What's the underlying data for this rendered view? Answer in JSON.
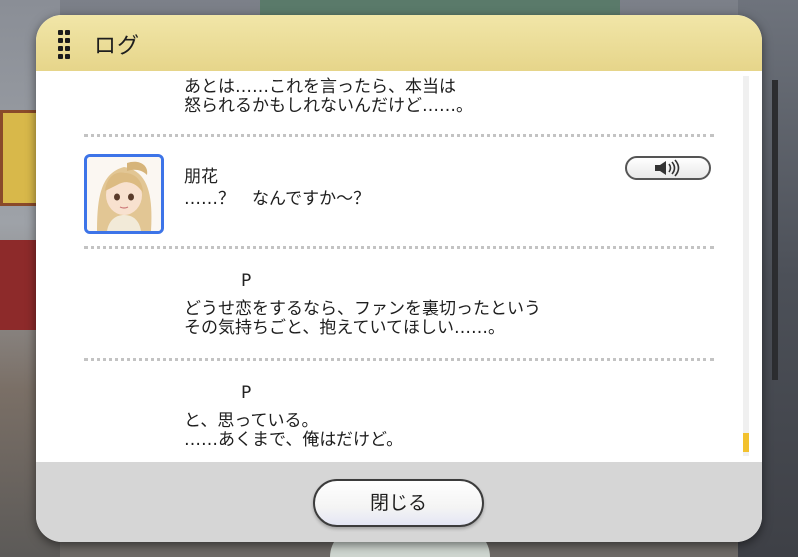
{
  "dialog": {
    "title": "ログ",
    "close_label": "閉じる"
  },
  "log": {
    "entries": [
      {
        "speaker": "",
        "lines": [
          "あとは……これを言ったら、本当は",
          "怒られるかもしれないんだけど……。"
        ]
      },
      {
        "speaker": "朋花",
        "lines": [
          "……？　なんですか～？"
        ],
        "has_voice": true
      },
      {
        "speaker": "P",
        "lines": [
          "どうせ恋をするなら、ファンを裏切ったという",
          "その気持ちごと、抱えていてほしい……。"
        ]
      },
      {
        "speaker": "P",
        "lines": [
          "と、思っている。",
          "……あくまで、俺はだけど。"
        ]
      }
    ]
  },
  "colors": {
    "header": "#ead98f",
    "avatar_border": "#3d74e8",
    "scroll_thumb": "#f2c12e"
  },
  "icons": {
    "grip": "drag-grip-icon",
    "voice": "speaker-volume-icon"
  }
}
